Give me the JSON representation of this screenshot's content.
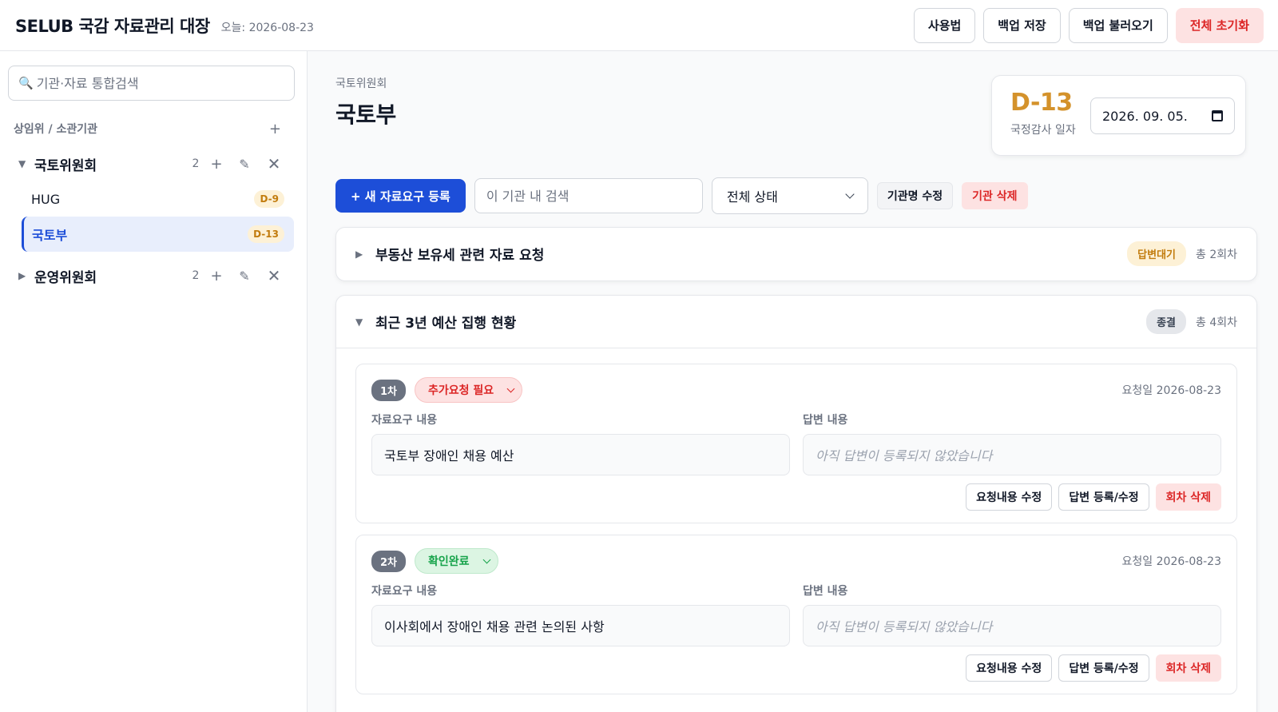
{
  "header": {
    "title": "SELUB 국감 자료관리 대장",
    "today": "오늘: 2026-08-23",
    "buttons": {
      "help": "사용법",
      "backup_save": "백업 저장",
      "backup_load": "백업 불러오기",
      "reset_all": "전체 초기화"
    }
  },
  "sidebar": {
    "search_placeholder": "기관·자료 통합검색",
    "section_label": "상임위 / 소관기관",
    "groups": [
      {
        "name": "국토위원회",
        "count": "2",
        "expanded": true,
        "orgs": [
          {
            "name": "HUG",
            "dday": "D-9",
            "active": false
          },
          {
            "name": "국토부",
            "dday": "D-13",
            "active": true
          }
        ]
      },
      {
        "name": "운영위원회",
        "count": "2",
        "expanded": false
      }
    ]
  },
  "main": {
    "breadcrumb": "국토위원회",
    "org_title": "국토부",
    "dday_card": {
      "dday": "D-13",
      "label": "국정감사 일자",
      "date": "2026. 09. 05."
    },
    "toolbar": {
      "new_request": "+ 새 자료요구 등록",
      "search_placeholder": "이 기관 내 검색",
      "status_filter": "전체 상태",
      "rename_org": "기관명 수정",
      "delete_org": "기관 삭제"
    },
    "requests": [
      {
        "title": "부동산 보유세 관련 자료 요청",
        "status": "답변대기",
        "total_rounds": "총 2회차",
        "expanded": false
      },
      {
        "title": "최근 3년 예산 집행 현황",
        "status": "종결",
        "total_rounds": "총 4회차",
        "expanded": true,
        "rounds": [
          {
            "badge": "1차",
            "status": "추가요청 필요",
            "request_date": "요청일 2026-08-23",
            "request_label": "자료요구 내용",
            "request_content": "국토부 장애인 채용 예산",
            "answer_label": "답변 내용",
            "answer_content": "아직 답변이 등록되지 않았습니다",
            "btn_edit_request": "요청내용 수정",
            "btn_answer": "답변 등록/수정",
            "btn_delete": "회차 삭제"
          },
          {
            "badge": "2차",
            "status": "확인완료",
            "request_date": "요청일 2026-08-23",
            "request_label": "자료요구 내용",
            "request_content": "이사회에서 장애인 채용 관련 논의된 사항",
            "answer_label": "답변 내용",
            "answer_content": "아직 답변이 등록되지 않았습니다",
            "btn_edit_request": "요청내용 수정",
            "btn_answer": "답변 등록/수정",
            "btn_delete": "회차 삭제"
          }
        ]
      }
    ]
  },
  "colors": {
    "primary": "#1d4ed8",
    "dday": "#d4922b",
    "danger": "#dc2626",
    "success": "#16a34a"
  }
}
